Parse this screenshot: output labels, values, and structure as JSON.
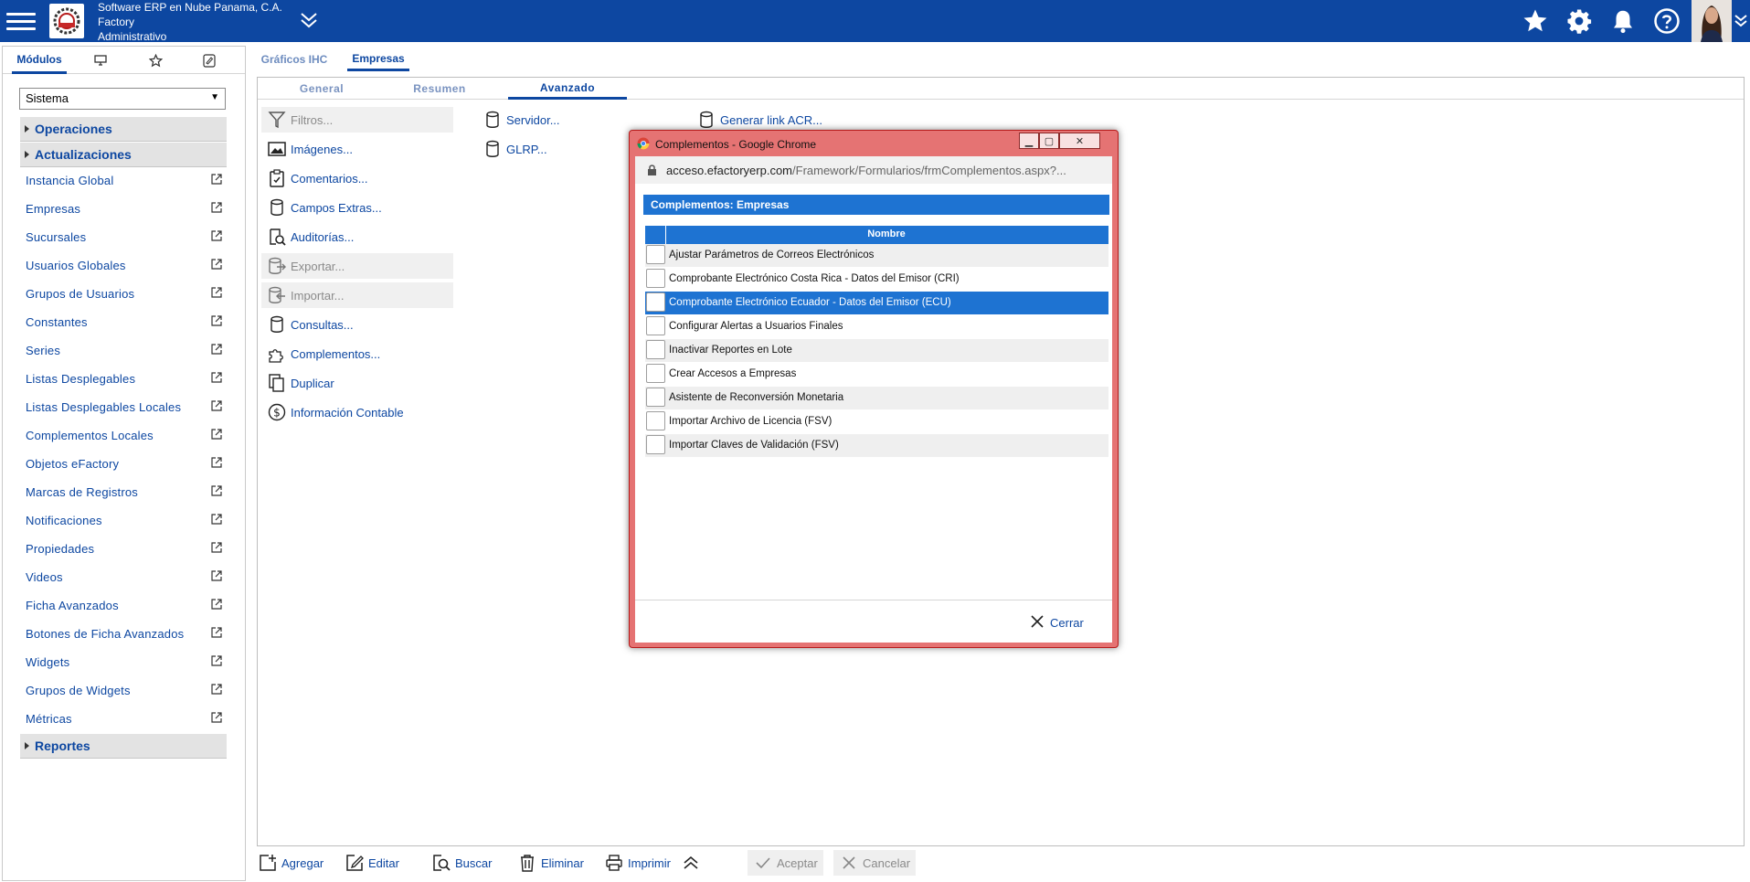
{
  "header": {
    "company_line1": "Software ERP en Nube Panama, C.A.",
    "company_line2": "Factory",
    "company_line3": "Administrativo",
    "icons": [
      "menu-icon",
      "star-icon",
      "gear-icon",
      "bell-icon",
      "help-icon"
    ],
    "brand_color": "#0d47a1"
  },
  "left": {
    "tabs": {
      "modulos": "Módulos"
    },
    "select_value": "Sistema",
    "sections": {
      "operaciones": "Operaciones",
      "actualizaciones": "Actualizaciones",
      "reportes": "Reportes"
    },
    "items": [
      "Instancia Global",
      "Empresas",
      "Sucursales",
      "Usuarios Globales",
      "Grupos de Usuarios",
      "Constantes",
      "Series",
      "Listas Desplegables",
      "Listas Desplegables Locales",
      "Complementos Locales",
      "Objetos eFactory",
      "Marcas de Registros",
      "Notificaciones",
      "Propiedades",
      "Videos",
      "Ficha Avanzados",
      "Botones de Ficha Avanzados",
      "Widgets",
      "Grupos de Widgets",
      "Métricas"
    ]
  },
  "content": {
    "tabs": [
      "Gráficos IHC",
      "Empresas"
    ],
    "subtabs": [
      "General",
      "Resumen",
      "Avanzado"
    ],
    "actions_col1": [
      "Filtros...",
      "Imágenes...",
      "Comentarios...",
      "Campos Extras...",
      "Auditorías...",
      "Exportar...",
      "Importar...",
      "Consultas...",
      "Complementos...",
      "Duplicar",
      "Información Contable"
    ],
    "actions_col2": [
      "Servidor...",
      "GLRP..."
    ],
    "actions_col3": [
      "Generar link ACR..."
    ]
  },
  "toolbar": {
    "agregar": "Agregar",
    "editar": "Editar",
    "buscar": "Buscar",
    "eliminar": "Eliminar",
    "imprimir": "Imprimir",
    "aceptar": "Aceptar",
    "cancelar": "Cancelar"
  },
  "dialog": {
    "window_title": "Complementos - Google Chrome",
    "url_host": "acceso.efactoryerp.com",
    "url_path": "/Framework/Formularios/frmComplementos.aspx?...",
    "header": "Complementos: Empresas",
    "column": "Nombre",
    "rows": [
      "Ajustar Parámetros de Correos Electrónicos",
      "Comprobante Electrónico Costa Rica - Datos del Emisor (CRI)",
      "Comprobante Electrónico Ecuador - Datos del Emisor (ECU)",
      "Configurar Alertas a Usuarios Finales",
      "Inactivar Reportes en Lote",
      "Crear Accesos a Empresas",
      "Asistente de Reconversión Monetaria",
      "Importar Archivo de Licencia (FSV)",
      "Importar Claves de Validación (FSV)"
    ],
    "selected_row": 3,
    "close": "Cerrar"
  }
}
